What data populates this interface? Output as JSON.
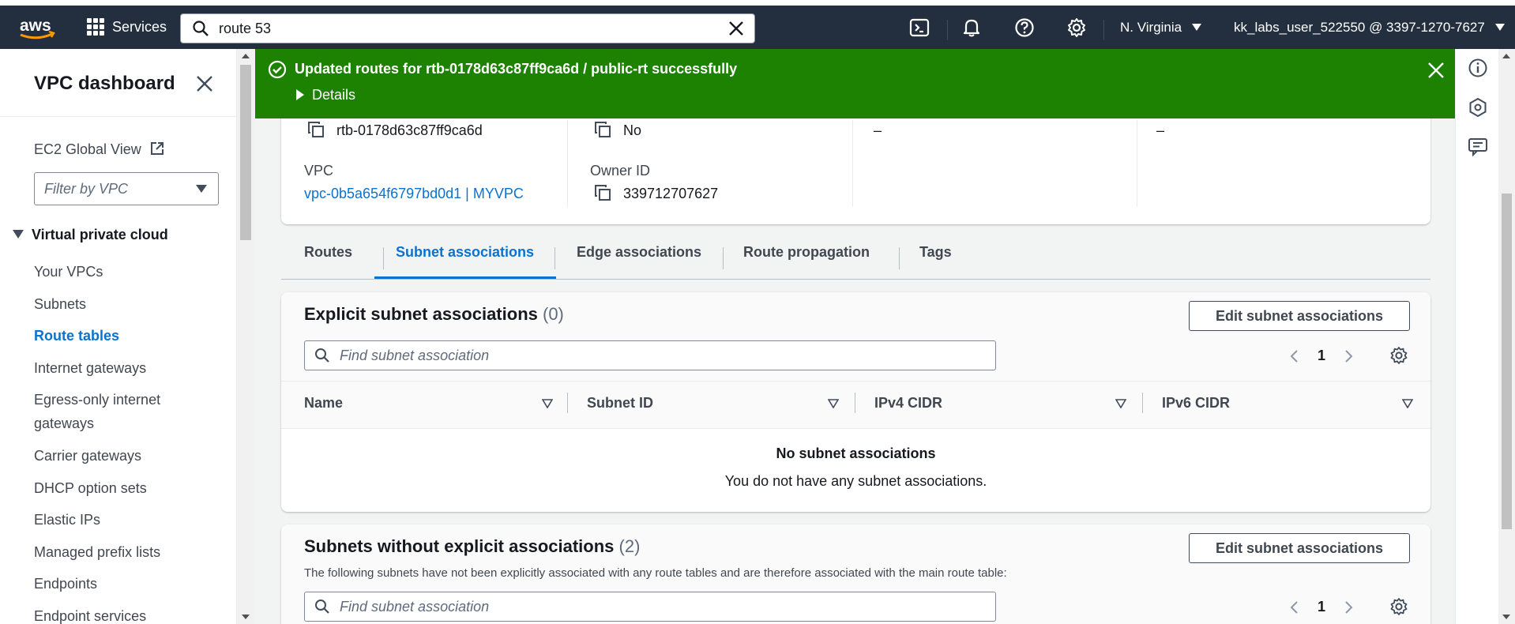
{
  "topnav": {
    "logo_text": "aws",
    "services_label": "Services",
    "search_value": "route 53",
    "region_label": "N. Virginia",
    "account_label": "kk_labs_user_522550 @ 3397-1270-7627"
  },
  "sidebar": {
    "title": "VPC dashboard",
    "ec2_global_view": "EC2 Global View",
    "filter_placeholder": "Filter by VPC",
    "section_title": "Virtual private cloud",
    "items": [
      {
        "label": "Your VPCs"
      },
      {
        "label": "Subnets"
      },
      {
        "label": "Route tables",
        "active": true
      },
      {
        "label": "Internet gateways"
      },
      {
        "label": "Egress-only internet"
      },
      {
        "label": "gateways"
      },
      {
        "label": "Carrier gateways"
      },
      {
        "label": "DHCP option sets"
      },
      {
        "label": "Elastic IPs"
      },
      {
        "label": "Managed prefix lists"
      },
      {
        "label": "Endpoints"
      },
      {
        "label": "Endpoint services"
      }
    ]
  },
  "banner": {
    "message": "Updated routes for rtb-0178d63c87ff9ca6d / public-rt successfully",
    "details_label": "Details"
  },
  "details": {
    "route_table_id": "rtb-0178d63c87ff9ca6d",
    "main_value": "No",
    "col3_value": "–",
    "col4_value": "–",
    "vpc_label": "VPC",
    "vpc_value": "vpc-0b5a654f6797bd0d1 | MYVPC",
    "owner_label": "Owner ID",
    "owner_value": "339712707627"
  },
  "tabs": [
    {
      "label": "Routes"
    },
    {
      "label": "Subnet associations",
      "active": true
    },
    {
      "label": "Edge associations"
    },
    {
      "label": "Route propagation"
    },
    {
      "label": "Tags"
    }
  ],
  "explicit": {
    "title": "Explicit subnet associations",
    "count": "(0)",
    "edit_button": "Edit subnet associations",
    "find_placeholder": "Find subnet association",
    "page": "1",
    "columns": [
      "Name",
      "Subnet ID",
      "IPv4 CIDR",
      "IPv6 CIDR"
    ],
    "empty_title": "No subnet associations",
    "empty_sub": "You do not have any subnet associations."
  },
  "implicit": {
    "title": "Subnets without explicit associations",
    "count": "(2)",
    "edit_button": "Edit subnet associations",
    "description": "The following subnets have not been explicitly associated with any route tables and are therefore associated with the main route table:",
    "find_placeholder": "Find subnet association",
    "page": "1"
  },
  "colors": {
    "nav_bg": "#232f3e",
    "success_green": "#1d8102",
    "link_blue": "#0972d3"
  },
  "icons": [
    "search-icon",
    "clear-icon",
    "grid-icon",
    "cloudshell-icon",
    "bell-icon",
    "help-icon",
    "gear-icon",
    "external-link-icon",
    "close-icon",
    "success-icon",
    "copy-icon",
    "chevron-left-icon",
    "chevron-right-icon",
    "sort-icon",
    "info-icon",
    "hexagon-icon",
    "feedback-icon"
  ]
}
